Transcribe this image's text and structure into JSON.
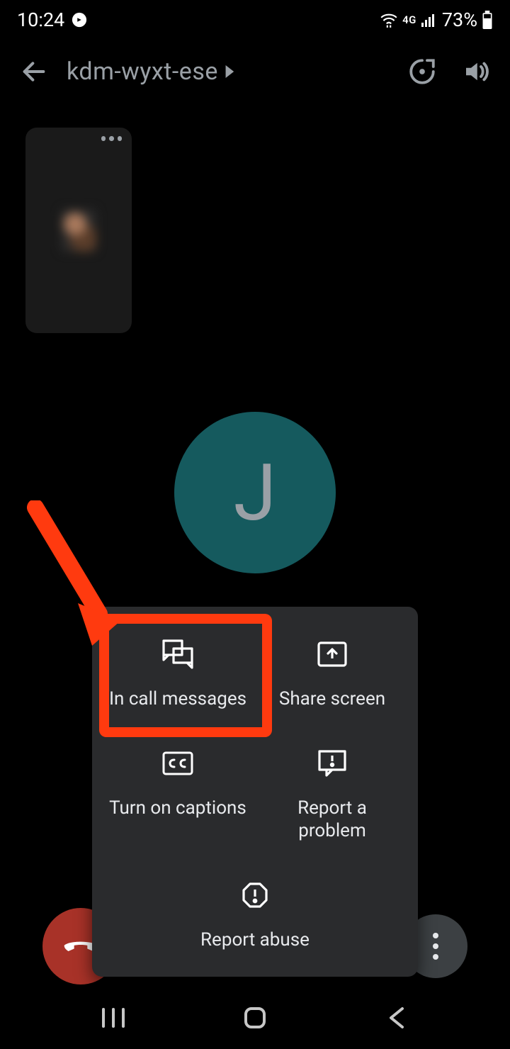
{
  "status_bar": {
    "time": "10:24",
    "battery_text": "73%",
    "network_label": "4G"
  },
  "app_bar": {
    "meeting_code": "kdm-wyxt-ese"
  },
  "avatar": {
    "letter": "J",
    "bg_color": "#155a5e"
  },
  "menu": {
    "in_call_messages": "In call messages",
    "share_screen": "Share screen",
    "turn_on_captions": "Turn on captions",
    "report_problem": "Report a problem",
    "report_abuse": "Report abuse"
  },
  "annotation": {
    "highlight_color": "#ff3a0f"
  }
}
